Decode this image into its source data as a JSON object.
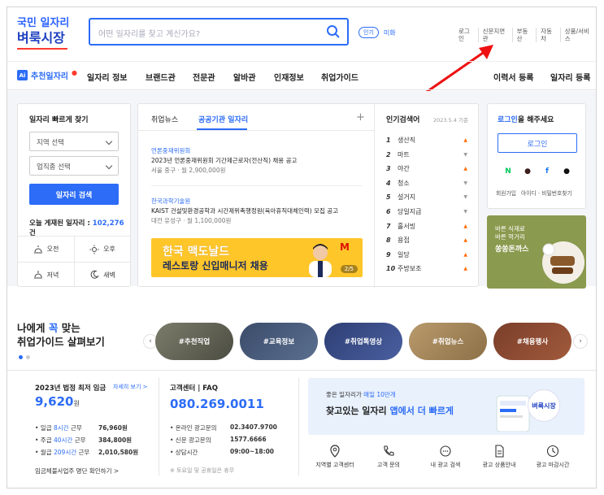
{
  "logo": {
    "line1": "국민 일자리",
    "line2": "벼룩시장"
  },
  "search": {
    "placeholder": "어떤 일자리를 찾고 계신가요?"
  },
  "popular": {
    "badge": "인기",
    "keyword": "미화"
  },
  "toplinks": [
    "로그인",
    "신문지면관",
    "부동산",
    "자동차",
    "상품/서비스"
  ],
  "nav": {
    "ai_badge": "Ai",
    "ai_label": "추천일자리",
    "items": [
      "일자리 정보",
      "브랜드관",
      "전문관",
      "알바관",
      "인재정보",
      "취업가이드"
    ],
    "right": [
      "이력서 등록",
      "일자리 등록"
    ]
  },
  "quick": {
    "title": "일자리 빠르게 찾기",
    "region": "지역 선택",
    "category": "업직종 선택",
    "button": "일자리 검색",
    "today_label": "오늘 게재된 일자리 : ",
    "today_count": "102,276",
    "today_unit": "건",
    "shifts": [
      "오전",
      "오후",
      "저녁",
      "새벽"
    ]
  },
  "news": {
    "tabs": [
      "취업뉴스",
      "공공기관 일자리"
    ],
    "items": [
      {
        "company": "언론중재위원회",
        "desc": "2023년 언론중재위원회 기간제근로자(전산직) 채용 공고",
        "meta": "서울 중구 · 월 2,900,000원"
      },
      {
        "company": "한국과학기술원",
        "desc": "KAIST 건설및환경공학과 시간제위촉행정원(육아휴직대체인력) 모집 공고",
        "meta": "대전 유성구 · 월 1,100,000원"
      }
    ],
    "banner": {
      "line1": "한국 맥도날드",
      "line2": "레스토랑 신입매니저 채용",
      "page": "2/5"
    }
  },
  "ranking": {
    "title": "인기검색어",
    "date": "2023.5.4 기준",
    "items": [
      {
        "n": "1",
        "w": "생산직",
        "t": "up"
      },
      {
        "n": "2",
        "w": "마트",
        "t": "down"
      },
      {
        "n": "3",
        "w": "야간",
        "t": "up"
      },
      {
        "n": "4",
        "w": "청소",
        "t": "down"
      },
      {
        "n": "5",
        "w": "설거지",
        "t": "down"
      },
      {
        "n": "6",
        "w": "당일지급",
        "t": "down"
      },
      {
        "n": "7",
        "w": "홀서빙",
        "t": "up"
      },
      {
        "n": "8",
        "w": "용접",
        "t": "up"
      },
      {
        "n": "9",
        "w": "일당",
        "t": "up"
      },
      {
        "n": "10",
        "w": "주방보조",
        "t": "up"
      }
    ]
  },
  "login": {
    "title_pre": "로그인",
    "title_post": "을 해주세요",
    "button": "로그인",
    "links": [
      "회원가입",
      "아이디 · 비밀번호찾기"
    ]
  },
  "ad": {
    "line1": "바른 식재료",
    "line2": "바른 먹거리",
    "line3": "쏭쏭돈까스"
  },
  "guide": {
    "title1_pre": "나에게 ",
    "title1_hl": "꼭",
    "title1_post": " 맞는",
    "title2": "취업가이드 살펴보기",
    "tags": [
      "#추천직업",
      "#교육정보",
      "#취업톡영상",
      "#취업뉴스",
      "#채용행사"
    ]
  },
  "wage": {
    "title": "2023년 법정 최저 임금",
    "more": "자세히 보기 >",
    "value": "9,620",
    "unit": "원",
    "rows": [
      {
        "pre": "• 일급 ",
        "hl": "8시간",
        "post": " 근무",
        "v": "76,960원"
      },
      {
        "pre": "• 주급 ",
        "hl": "40시간",
        "post": " 근무",
        "v": "384,800원"
      },
      {
        "pre": "• 월급 ",
        "hl": "209시간",
        "post": " 근무",
        "v": "2,010,580원"
      }
    ],
    "check": "임금체불사업주 명단 확인하기 >"
  },
  "center": {
    "title": "고객센터 | FAQ",
    "phone": "080.269.0011",
    "rows": [
      {
        "k": "• 온라인 광고문의",
        "v": "02.3407.9700"
      },
      {
        "k": "• 신문 광고문의",
        "v": "1577.6666"
      },
      {
        "k": "• 상담시간",
        "v": "09:00~18:00"
      }
    ],
    "note": "※ 토요일 및 공휴일은 휴무"
  },
  "app": {
    "sub_pre": "좋은 일자리가 ",
    "sub_hl": "매일 10만개",
    "main_pre": "찾고있는 일자리 ",
    "main_hl": "앱에서 더 빠르게",
    "logo": "벼룩시장"
  },
  "services": [
    "지역별 고객센터",
    "고객 문의",
    "내 광고 검색",
    "광고 상품안내",
    "광고 마감시간"
  ],
  "colors": {
    "accent": "#2c6cf6",
    "logo_red": "#ff3b30",
    "arrow": "#ee1111"
  }
}
